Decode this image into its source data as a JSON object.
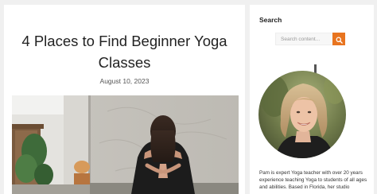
{
  "post": {
    "title": "4 Places to Find Beginner Yoga Classes",
    "date": "August 10, 2023"
  },
  "sidebar": {
    "search": {
      "title": "Search",
      "placeholder": "Search content...",
      "button_icon": "search-icon"
    },
    "bio": "Pam is expert Yoga teacher with over 20 years experience teaching Yoga to students of all ages and abilities. Based in Florida, her studio"
  },
  "colors": {
    "accent": "#e8741f",
    "page_background": "#f0f0f0",
    "card_background": "#ffffff"
  }
}
